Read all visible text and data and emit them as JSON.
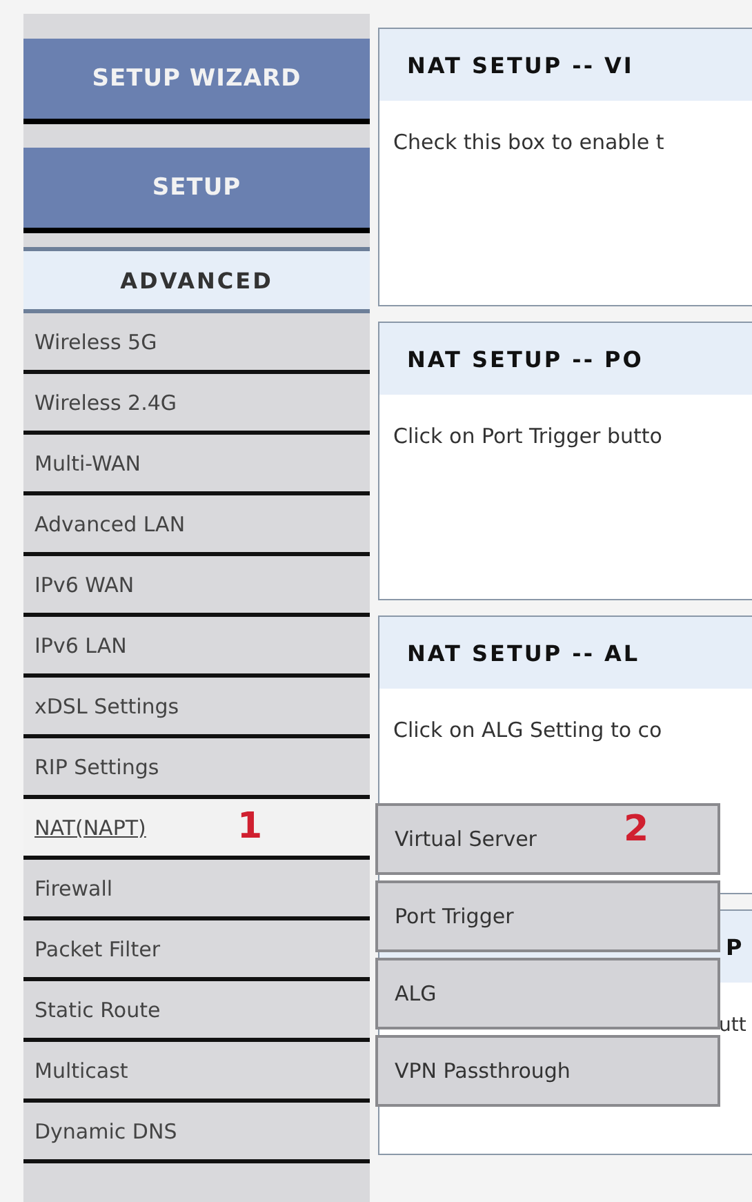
{
  "sidebar": {
    "top_buttons": [
      {
        "label": "SETUP WIZARD"
      },
      {
        "label": "SETUP"
      }
    ],
    "section": {
      "label": "ADVANCED"
    },
    "items": [
      {
        "label": "Wireless 5G",
        "selected": false
      },
      {
        "label": "Wireless 2.4G",
        "selected": false
      },
      {
        "label": "Multi-WAN",
        "selected": false
      },
      {
        "label": "Advanced LAN",
        "selected": false
      },
      {
        "label": "IPv6 WAN",
        "selected": false
      },
      {
        "label": "IPv6 LAN",
        "selected": false
      },
      {
        "label": "xDSL Settings",
        "selected": false
      },
      {
        "label": "RIP Settings",
        "selected": false
      },
      {
        "label": "NAT(NAPT)",
        "selected": true,
        "annotation": "1"
      },
      {
        "label": "Firewall",
        "selected": false
      },
      {
        "label": "Packet Filter",
        "selected": false
      },
      {
        "label": "Static Route",
        "selected": false
      },
      {
        "label": "Multicast",
        "selected": false
      },
      {
        "label": "Dynamic DNS",
        "selected": false
      }
    ]
  },
  "submenu": {
    "items": [
      {
        "label": "Virtual Server",
        "annotation": "2"
      },
      {
        "label": "Port Trigger"
      },
      {
        "label": "ALG"
      },
      {
        "label": "VPN Passthrough"
      }
    ]
  },
  "panels": [
    {
      "title": "NAT SETUP -- VI",
      "body": "Check this box to enable t",
      "covered": false
    },
    {
      "title": "NAT SETUP -- PO",
      "body": "Click on Port Trigger butto",
      "covered": false
    },
    {
      "title": "NAT SETUP -- AL",
      "body": "Click on ALG Setting to co",
      "covered": false
    },
    {
      "title": "P",
      "body": "utt",
      "covered": true
    }
  ]
}
